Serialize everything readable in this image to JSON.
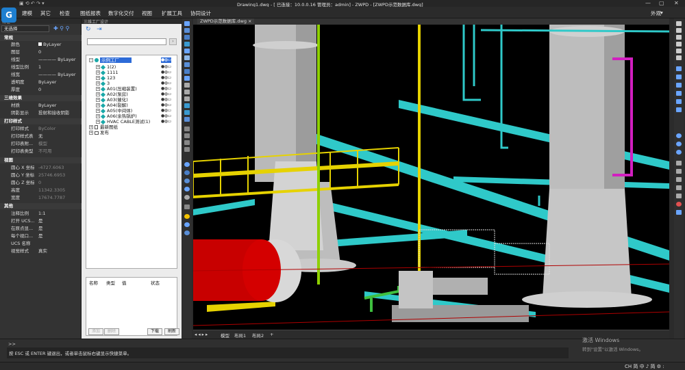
{
  "window": {
    "title": "Drawing1.dwg - [ 已连接：10.0.0.16 管理员：admin] - ZWPD - [ZWPD示范数据库.dwg]"
  },
  "menu": {
    "items": [
      "建模",
      "其它",
      "检查",
      "图纸报表",
      "数字化交付",
      "视图",
      "扩展工具",
      "协同设计"
    ],
    "right_label": "外观"
  },
  "properties_panel": {
    "title": "特性",
    "selection": "无选择",
    "sections": [
      {
        "title": "常规",
        "rows": [
          {
            "key": "颜色",
            "value": "ByLayer"
          },
          {
            "key": "图层",
            "value": "0"
          },
          {
            "key": "线型",
            "value": "———— ByLayer"
          },
          {
            "key": "线型比例",
            "value": "1"
          },
          {
            "key": "线宽",
            "value": "———— ByLayer"
          },
          {
            "key": "透明度",
            "value": "ByLayer"
          },
          {
            "key": "厚度",
            "value": "0"
          }
        ]
      },
      {
        "title": "三维效果",
        "rows": [
          {
            "key": "材质",
            "value": "ByLayer"
          },
          {
            "key": "阴影显示",
            "value": "投射和接收阴影"
          }
        ]
      },
      {
        "title": "打印样式",
        "rows": [
          {
            "key": "打印样式",
            "value": "ByColor"
          },
          {
            "key": "打印样式表",
            "value": "无"
          },
          {
            "key": "打印表附...",
            "value": "模型"
          },
          {
            "key": "打印表类型",
            "value": "不可用"
          }
        ]
      },
      {
        "title": "视图",
        "rows": [
          {
            "key": "圆心 X 坐标",
            "value": "-4727.6063"
          },
          {
            "key": "圆心 Y 坐标",
            "value": "25746.6953"
          },
          {
            "key": "圆心 Z 坐标",
            "value": "0"
          },
          {
            "key": "高度",
            "value": "11342.3305"
          },
          {
            "key": "宽度",
            "value": "17674.7787"
          }
        ]
      },
      {
        "title": "其他",
        "rows": [
          {
            "key": "注释比例",
            "value": "1:1"
          },
          {
            "key": "打开 UCS...",
            "value": "是"
          },
          {
            "key": "在原点显...",
            "value": "是"
          },
          {
            "key": "每个视口...",
            "value": "是"
          },
          {
            "key": "UCS 名称",
            "value": ""
          },
          {
            "key": "视觉样式",
            "value": "真实"
          }
        ]
      }
    ]
  },
  "factory_panel": {
    "title": "三维工厂设计",
    "tree": [
      {
        "label": "示例工厂",
        "selected": true,
        "level": 0
      },
      {
        "label": "1(2)",
        "level": 1
      },
      {
        "label": "1111",
        "level": 1
      },
      {
        "label": "123",
        "level": 1
      },
      {
        "label": "3",
        "level": 1
      },
      {
        "label": "A01(压缩装置)",
        "level": 1
      },
      {
        "label": "A02(泵房)",
        "level": 1
      },
      {
        "label": "A03(催化)",
        "level": 1
      },
      {
        "label": "A04(裂解)",
        "level": 1
      },
      {
        "label": "A05(中间体)",
        "level": 1
      },
      {
        "label": "A06(余热锅炉)",
        "level": 1
      },
      {
        "label": "HVAC CABLE测试(1)",
        "level": 1
      },
      {
        "label": "最新图纸",
        "level": 0
      },
      {
        "label": "发布",
        "level": 0
      }
    ],
    "table_headers": [
      "名称",
      "类型",
      "值",
      "状态"
    ],
    "buttons": {
      "add": "添加",
      "delete": "删除",
      "download": "下载",
      "refresh": "刷新"
    }
  },
  "viewport": {
    "tab": "ZWPD示范数据库.dwg",
    "layout_tabs": [
      "模型",
      "布局1",
      "布局2"
    ]
  },
  "command": {
    "history": ">>",
    "prompt": "按 ESC 或 ENTER 键退出，或者单击鼠标右键显示快捷菜单。"
  },
  "watermark": {
    "line1": "激活 Windows",
    "line2": "转到\"设置\"以激活 Windows。"
  },
  "status": {
    "ime": "CH 简 中 ♪ 简 ⚙ :"
  },
  "colors": {
    "accent": "#2d6bd8",
    "pipe_green": "#8ed000",
    "pipe_cyan": "#2fc9c9",
    "pipe_magenta": "#d21fc0",
    "vessel_red": "#d40000",
    "railing_yellow": "#e6d200"
  }
}
